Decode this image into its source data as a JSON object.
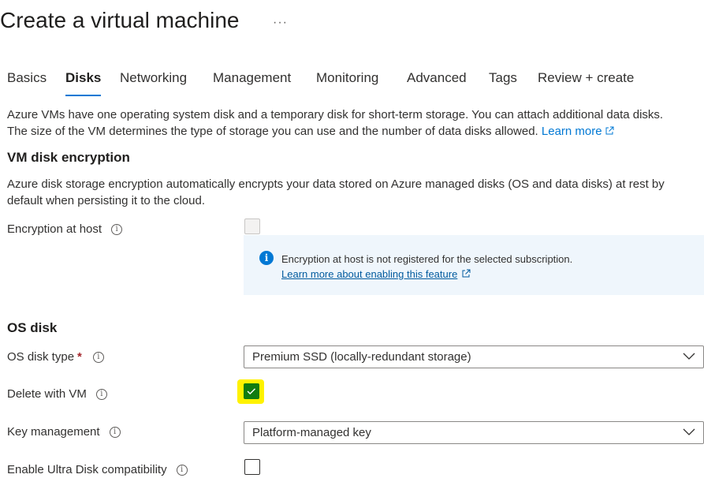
{
  "header": {
    "title": "Create a virtual machine",
    "more": "···"
  },
  "tabs": [
    {
      "label": "Basics"
    },
    {
      "label": "Disks",
      "active": true
    },
    {
      "label": "Networking"
    },
    {
      "label": "Management"
    },
    {
      "label": "Monitoring"
    },
    {
      "label": "Advanced"
    },
    {
      "label": "Tags"
    },
    {
      "label": "Review + create"
    }
  ],
  "intro": {
    "line1": "Azure VMs have one operating system disk and a temporary disk for short-term storage. You can attach additional data disks.",
    "line2": "The size of the VM determines the type of storage you can use and the number of data disks allowed.",
    "learn_more": "Learn more"
  },
  "encryption": {
    "heading": "VM disk encryption",
    "description_line1": "Azure disk storage encryption automatically encrypts your data stored on Azure managed disks (OS and data disks) at rest by",
    "description_line2": "default when persisting it to the cloud.",
    "host_label": "Encryption at host",
    "host_checked": false,
    "host_disabled": true,
    "info_message": "Encryption at host is not registered for the selected subscription.",
    "info_link": "Learn more about enabling this feature"
  },
  "os_disk": {
    "heading": "OS disk",
    "type_label": "OS disk type",
    "required_mark": "*",
    "type_value": "Premium SSD (locally-redundant storage)",
    "delete_label": "Delete with VM",
    "delete_checked": true,
    "key_label": "Key management",
    "key_value": "Platform-managed key",
    "ultra_label": "Enable Ultra Disk compatibility",
    "ultra_checked": false
  },
  "icons": {
    "info": "info-icon",
    "external_link": "external-link-icon",
    "chevron": "chevron-down-icon"
  },
  "colors": {
    "accent": "#0078d4",
    "checkbox_checked": "#107c10",
    "highlight": "#fff200",
    "info_bg": "#eff6fc"
  }
}
